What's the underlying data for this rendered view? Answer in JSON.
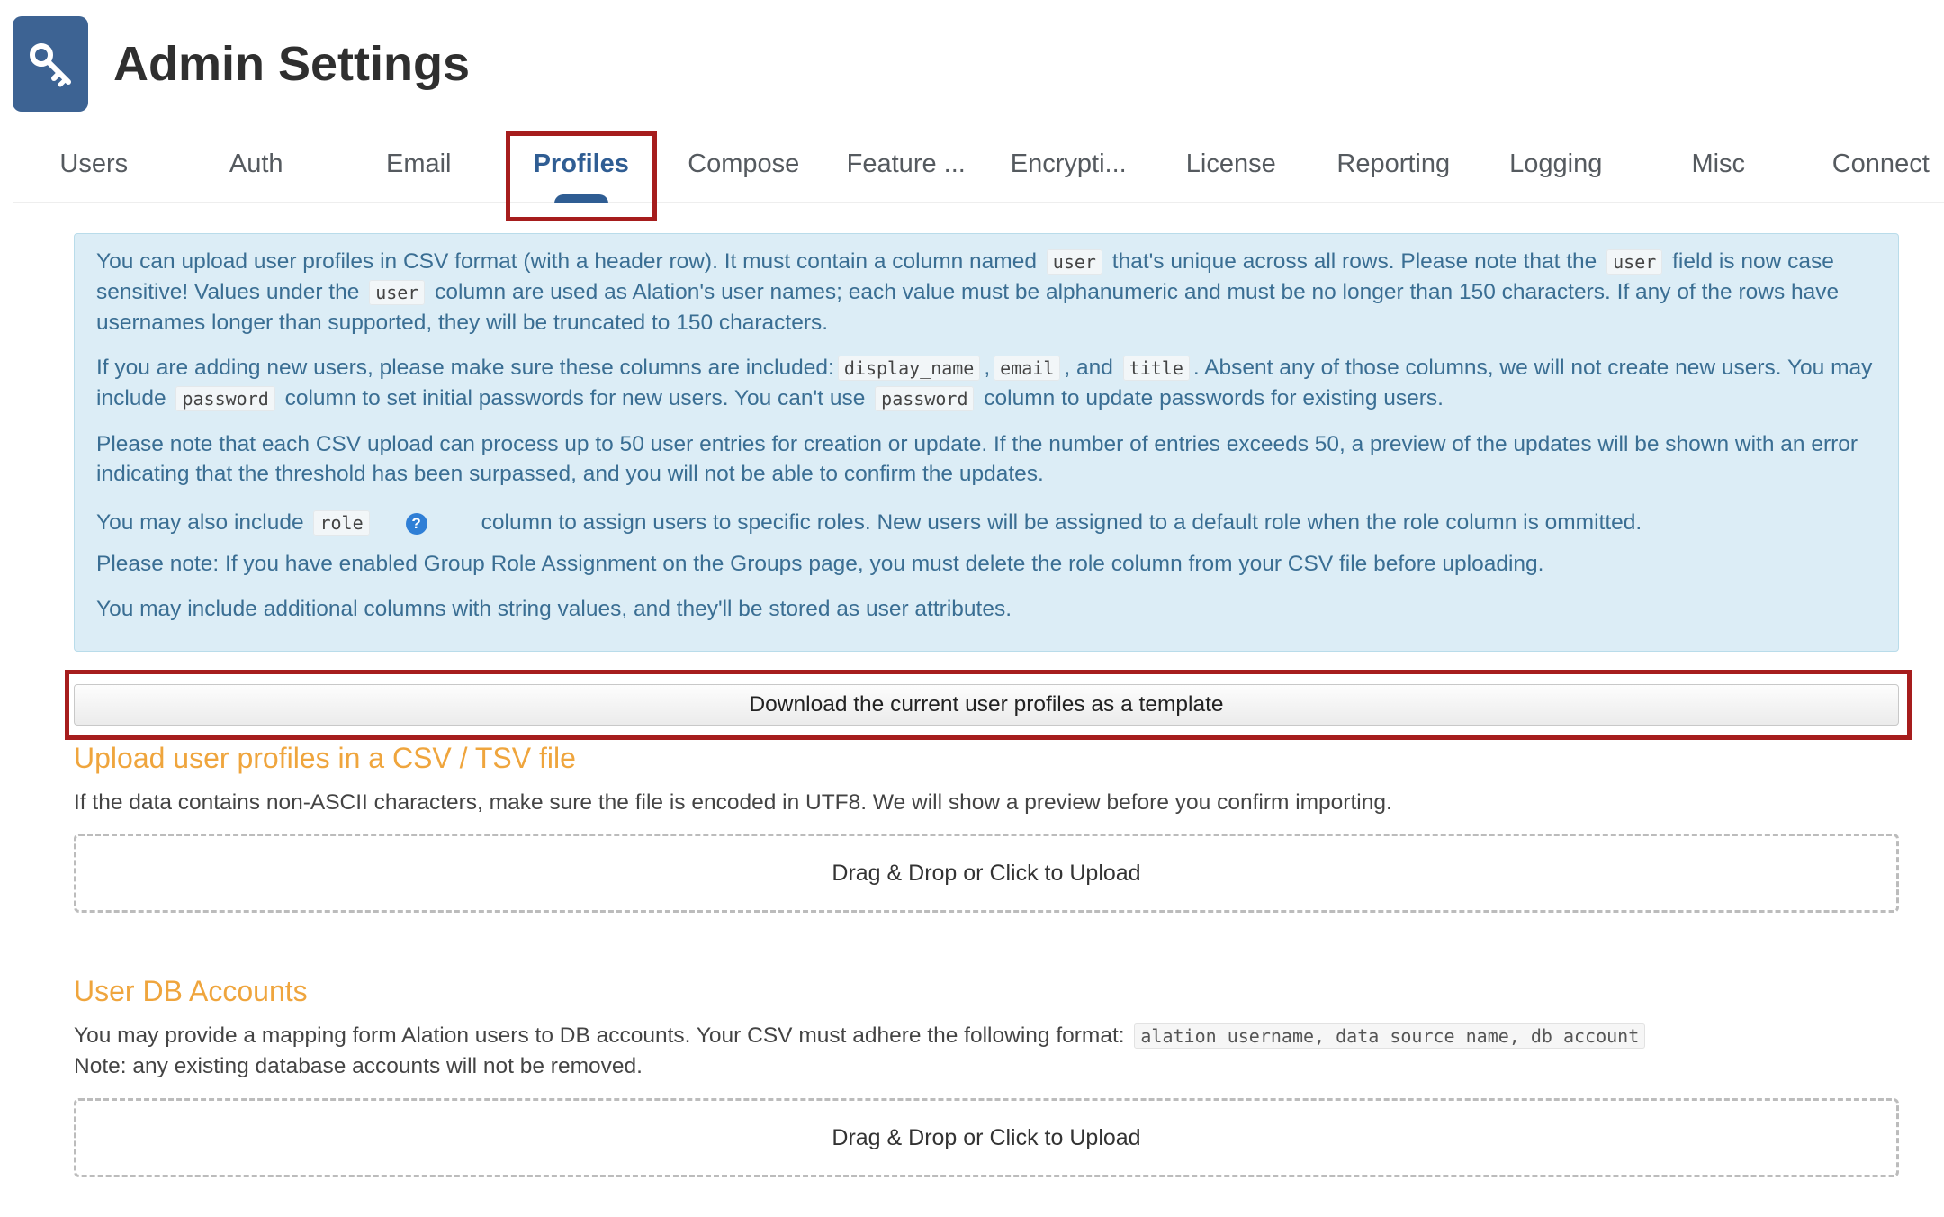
{
  "header": {
    "title": "Admin Settings",
    "icon": "key-icon",
    "icon_bg": "#3d6393"
  },
  "tabs": [
    {
      "label": "Users"
    },
    {
      "label": "Auth"
    },
    {
      "label": "Email"
    },
    {
      "label": "Profiles",
      "active": true
    },
    {
      "label": "Compose"
    },
    {
      "label": "Feature ..."
    },
    {
      "label": "Encrypti..."
    },
    {
      "label": "License"
    },
    {
      "label": "Reporting"
    },
    {
      "label": "Logging"
    },
    {
      "label": "Misc"
    },
    {
      "label": "Connect"
    }
  ],
  "info": {
    "p1": {
      "t1": "You can upload user profiles in CSV format (with a header row). It must contain a column named",
      "c1": "user",
      "t2": "that's unique across all rows. Please note that the",
      "c2": "user",
      "t3": "field is now case sensitive! Values under the",
      "c3": "user",
      "t4": "column are used as Alation's user names; each value must be alphanumeric and must be no longer than 150 characters. If any of the rows have usernames longer than supported, they will be truncated to 150 characters."
    },
    "p2": {
      "t1": "If you are adding new users, please make sure these columns are included:",
      "c1": "display_name",
      "t2": ",",
      "c2": "email",
      "t3": ", and",
      "c3": "title",
      "t4": ". Absent any of those columns, we will not create new users. You may include",
      "c4": "password",
      "t5": "column to set initial passwords for new users. You can't use",
      "c5": "password",
      "t6": "column to update passwords for existing users."
    },
    "p3": "Please note that each CSV upload can process up to 50 user entries for creation or update. If the number of entries exceeds 50, a preview of the updates will be shown with an error indicating that the threshold has been surpassed, and you will not be able to confirm the updates.",
    "p4": {
      "t1": "You may also include",
      "c1": "role",
      "help": "?",
      "t2": "column to assign users to specific roles. New users will be assigned to a default role when the role column is ommitted."
    },
    "p5": {
      "t1": "Please note: If you have enabled Group Role Assignment on the",
      "link": "Groups page",
      "t2": ", you must delete the role column from your CSV file before uploading."
    },
    "p6": "You may include additional columns with string values, and they'll be stored as user attributes."
  },
  "download_button": "Download the current user profiles as a template",
  "upload_section": {
    "title": "Upload user profiles in a CSV / TSV file",
    "description": "If the data contains non-ASCII characters, make sure the file is encoded in UTF8. We will show a preview before you confirm importing.",
    "dropzone": "Drag & Drop or Click to Upload"
  },
  "db_section": {
    "title": "User DB Accounts",
    "t1": "You may provide a mapping form Alation users to DB accounts. Your CSV must adhere the following format:",
    "format": "alation username, data source name, db account",
    "note": "Note: any existing database accounts will not be removed.",
    "dropzone": "Drag & Drop or Click to Upload"
  },
  "colors": {
    "accent": "#2f5d93",
    "highlight": "#a61d1d",
    "section_title": "#efa53d",
    "info_text": "#3a6e93",
    "info_bg": "#dcedf6"
  }
}
